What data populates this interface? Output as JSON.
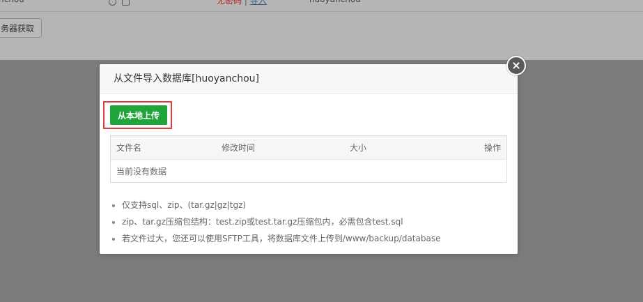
{
  "background": {
    "row_left_text": "nchou",
    "row_status_text": "无密码",
    "row_sep": "|",
    "row_link_text": "导入",
    "row_username": "huoyanchou",
    "side_button_label": "务器获取"
  },
  "modal": {
    "title": "从文件导入数据库[huoyanchou]",
    "upload_button": "从本地上传",
    "table": {
      "headers": [
        "文件名",
        "修改时间",
        "大小",
        "操作"
      ],
      "empty_text": "当前没有数据"
    },
    "notes": [
      "仅支持sql、zip、(tar.gz|gz|tgz)",
      "zip、tar.gz压缩包结构：test.zip或test.tar.gz压缩包内，必需包含test.sql",
      "若文件过大，您还可以使用SFTP工具，将数据库文件上传到/www/backup/database"
    ]
  },
  "colors": {
    "upload_button": "#20a53a",
    "highlight_border": "#e23c3c",
    "overlay": "#7b7b7b"
  },
  "icons": [
    "close-icon",
    "history-icon",
    "file-icon"
  ]
}
